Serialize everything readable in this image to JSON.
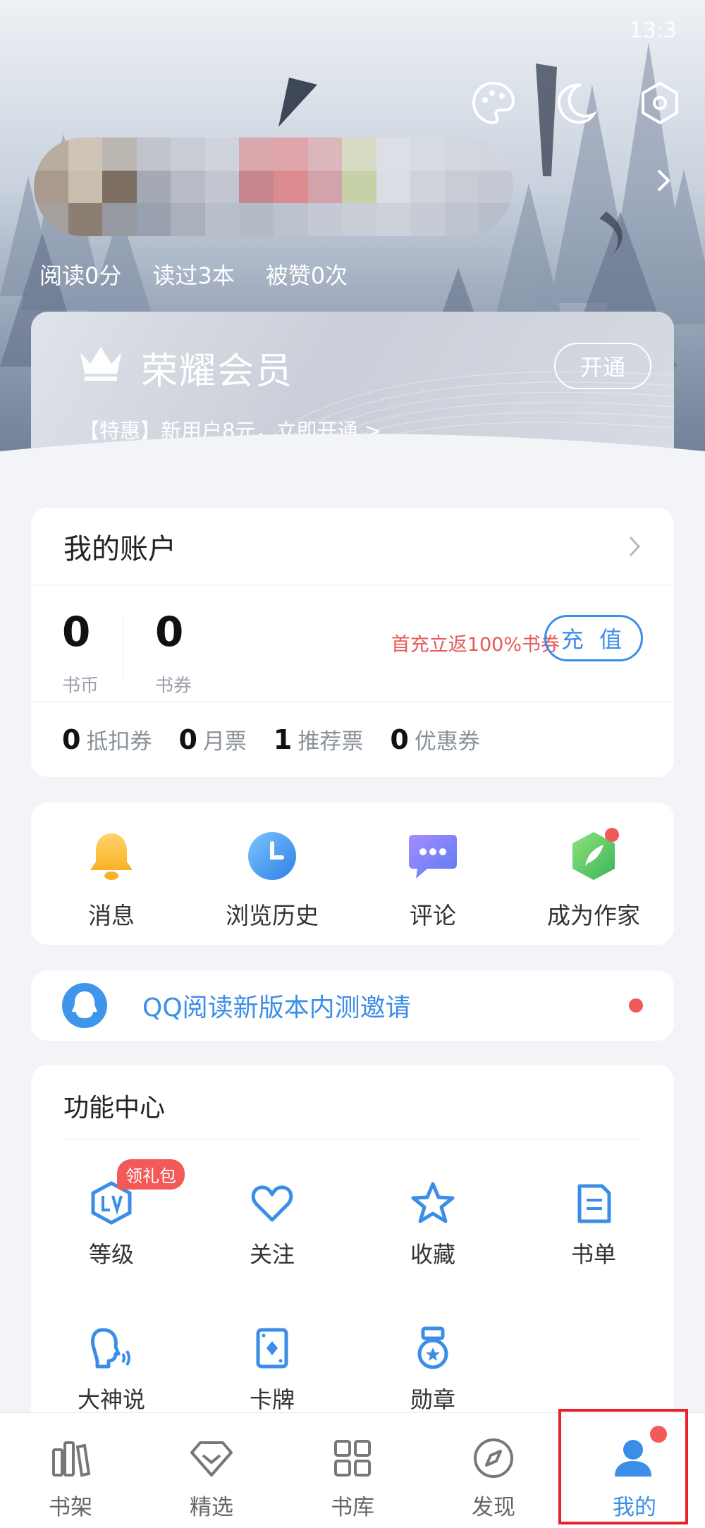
{
  "status": {
    "time": "13:3"
  },
  "header": {
    "icons": [
      "palette-icon",
      "moon-icon",
      "settings-hex-icon"
    ],
    "stats": [
      {
        "label": "阅读0分"
      },
      {
        "label": "读过3本"
      },
      {
        "label": "被赞0次"
      }
    ]
  },
  "vip": {
    "title": "荣耀会员",
    "button": "开通",
    "promo": "【特惠】新用户8元，立即开通 >"
  },
  "account": {
    "title": "我的账户",
    "coins": {
      "value": "0",
      "label": "书币"
    },
    "vouchers": {
      "value": "0",
      "label": "书券"
    },
    "promo": "首充立返100%书券",
    "recharge": "充 值",
    "coupons": [
      {
        "n": "0",
        "label": "抵扣券"
      },
      {
        "n": "0",
        "label": "月票"
      },
      {
        "n": "1",
        "label": "推荐票"
      },
      {
        "n": "0",
        "label": "优惠券"
      }
    ]
  },
  "quick": [
    {
      "label": "消息",
      "icon": "bell-icon"
    },
    {
      "label": "浏览历史",
      "icon": "clock-icon"
    },
    {
      "label": "评论",
      "icon": "chat-icon"
    },
    {
      "label": "成为作家",
      "icon": "feather-icon"
    }
  ],
  "invite": {
    "text": "QQ阅读新版本内测邀请"
  },
  "func": {
    "title": "功能中心",
    "badge": "领礼包",
    "items": [
      {
        "label": "等级",
        "icon": "level-icon"
      },
      {
        "label": "关注",
        "icon": "heart-icon"
      },
      {
        "label": "收藏",
        "icon": "star-icon"
      },
      {
        "label": "书单",
        "icon": "booklist-icon"
      },
      {
        "label": "大神说",
        "icon": "speaker-icon"
      },
      {
        "label": "卡牌",
        "icon": "card-icon"
      },
      {
        "label": "勋章",
        "icon": "medal-icon"
      }
    ]
  },
  "tabs": [
    {
      "label": "书架",
      "icon": "bookshelf-icon"
    },
    {
      "label": "精选",
      "icon": "diamond-icon"
    },
    {
      "label": "书库",
      "icon": "grid-icon"
    },
    {
      "label": "发现",
      "icon": "compass-icon"
    },
    {
      "label": "我的",
      "icon": "user-icon"
    }
  ],
  "colors": {
    "accent": "#3b8ee8",
    "alert": "#f25a5a",
    "highlight": "#e8202a"
  }
}
